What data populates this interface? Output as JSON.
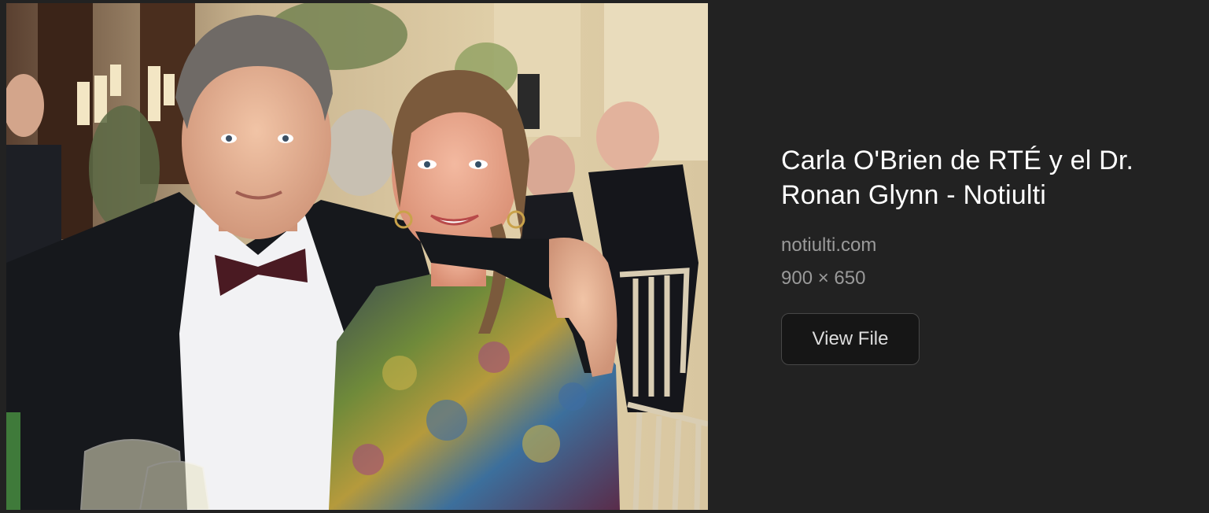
{
  "image": {
    "alt": "Carla O'Brien de RTÉ y el Dr. Ronan Glynn - Notiulti"
  },
  "details": {
    "title": "Carla O'Brien de RTÉ y el Dr. Ronan Glynn - Notiulti",
    "source": "notiulti.com",
    "dimensions": "900 × 650",
    "view_file_label": "View File"
  },
  "colors": {
    "background": "#222222",
    "title_text": "#ffffff",
    "meta_text": "#9a9a9a",
    "button_background": "#161616",
    "button_border": "#474747"
  }
}
